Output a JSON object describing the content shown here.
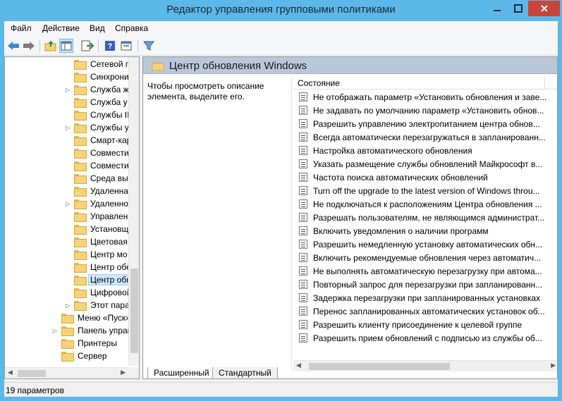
{
  "window": {
    "title": "Редактор управления групповыми политиками",
    "close_color": "#c7453a",
    "frame_color": "#5bb8e8"
  },
  "menu": [
    "Файл",
    "Действие",
    "Вид",
    "Справка"
  ],
  "toolbar": {
    "icons": [
      "back-arrow-icon",
      "forward-arrow-icon",
      "folder-up-icon",
      "show-hide-tree-icon",
      "export-list-icon",
      "help-icon",
      "properties-icon",
      "filter-icon"
    ]
  },
  "tree": {
    "items": [
      {
        "label": "Сетевой п",
        "indent": 2,
        "expandable": false
      },
      {
        "label": "Синхрони",
        "indent": 2,
        "expandable": false
      },
      {
        "label": "Служба ж",
        "indent": 2,
        "expandable": true
      },
      {
        "label": "Служба у",
        "indent": 2,
        "expandable": false
      },
      {
        "label": "Службы II",
        "indent": 2,
        "expandable": false
      },
      {
        "label": "Службы у",
        "indent": 2,
        "expandable": true
      },
      {
        "label": "Смарт-кар",
        "indent": 2,
        "expandable": false
      },
      {
        "label": "Совмести",
        "indent": 2,
        "expandable": false
      },
      {
        "label": "Совмести",
        "indent": 2,
        "expandable": false
      },
      {
        "label": "Среда вып",
        "indent": 2,
        "expandable": false
      },
      {
        "label": "Удаленная",
        "indent": 2,
        "expandable": false
      },
      {
        "label": "Удаленно",
        "indent": 2,
        "expandable": true
      },
      {
        "label": "Управлен",
        "indent": 2,
        "expandable": false
      },
      {
        "label": "Установщ",
        "indent": 2,
        "expandable": false
      },
      {
        "label": "Цветовая",
        "indent": 2,
        "expandable": false
      },
      {
        "label": "Центр мо",
        "indent": 2,
        "expandable": false
      },
      {
        "label": "Центр обе",
        "indent": 2,
        "expandable": false
      },
      {
        "label": "Центр обн",
        "indent": 2,
        "expandable": false,
        "selected": true
      },
      {
        "label": "Цифровой",
        "indent": 2,
        "expandable": false
      },
      {
        "label": "Этот пара",
        "indent": 2,
        "expandable": true
      },
      {
        "label": "Меню «Пуск»",
        "indent": 1,
        "expandable": false
      },
      {
        "label": "Панель управ",
        "indent": 1,
        "expandable": true
      },
      {
        "label": "Принтеры",
        "indent": 1,
        "expandable": false
      },
      {
        "label": "Сервер",
        "indent": 1,
        "expandable": false
      }
    ]
  },
  "details": {
    "header_title": "Центр обновления Windows",
    "description": "Чтобы просмотреть описание элемента, выделите его.",
    "column_state": "Состояние",
    "rows": [
      "Не отображать параметр «Установить обновления и заве...",
      "Не задавать по умолчанию параметр «Установить обнов...",
      "Разрешить управлению электропитанием центра обнов...",
      "Всегда автоматически перезагружаться в запланированн...",
      "Настройка автоматического обновления",
      "Указать размещение службы обновлений Майкрософт в...",
      "Частота поиска автоматических обновлений",
      "Turn off the upgrade to the latest version of Windows throu...",
      "Не подключаться к расположениям Центра обновления ...",
      "Разрешать пользователям, не являющимся администрат...",
      "Включить уведомления о наличии программ",
      "Разрешить немедленную установку автоматических обн...",
      "Включить рекомендуемые обновления через автоматич...",
      "Не выполнять автоматическую перезагрузку при автома...",
      "Повторный запрос для перезагрузки при запланированн...",
      "Задержка перезагрузки при запланированных установках",
      "Перенос запланированных автоматических установок об...",
      "Разрешить клиенту присоединение к целевой группе",
      "Разрешить прием обновлений с подписью из службы об..."
    ]
  },
  "tabs": [
    "Расширенный",
    "Стандартный"
  ],
  "status": "19 параметров"
}
